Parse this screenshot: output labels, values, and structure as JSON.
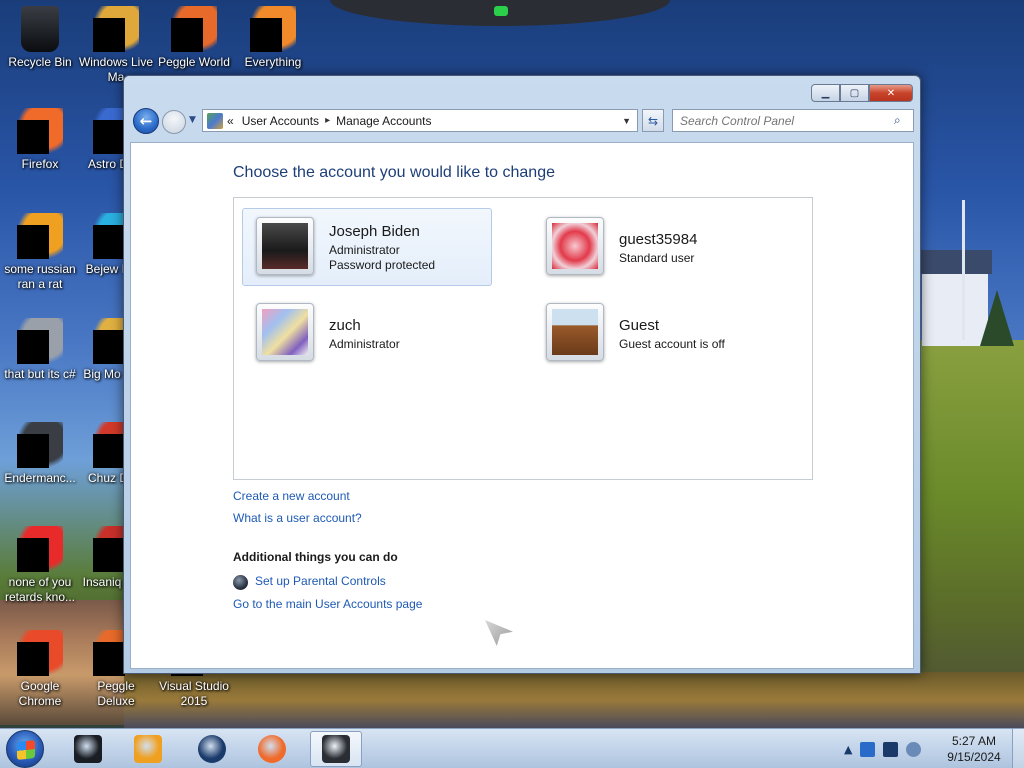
{
  "desktop": {
    "icons": [
      {
        "label": "Recycle Bin",
        "icon": "recycle-bin-icon",
        "color": "#1a1e24"
      },
      {
        "label": "Windows Live Ma",
        "icon": "windows-live-icon",
        "color": "#e0a83a"
      },
      {
        "label": "Peggle World",
        "icon": "peggle-world-icon",
        "color": "#e86a2a"
      },
      {
        "label": "Everything",
        "icon": "everything-icon",
        "color": "#f08a2a"
      },
      {
        "label": "Firefox",
        "icon": "firefox-icon",
        "color": "#f06a2a"
      },
      {
        "label": "Astro Delu",
        "icon": "astro-icon",
        "color": "#3a6ad0"
      },
      {
        "label": "some russian ran a rat",
        "icon": "shortcut-icon",
        "color": "#f0a020"
      },
      {
        "label": "Bejew Delu",
        "icon": "bejeweled-icon",
        "color": "#2ab0e0"
      },
      {
        "label": "that but its c#",
        "icon": "shortcut-icon",
        "color": "#9aa0aa"
      },
      {
        "label": "Big Mo Delu",
        "icon": "game-icon",
        "color": "#e0b040"
      },
      {
        "label": "Endermanc...",
        "icon": "app-icon",
        "color": "#3a3e44"
      },
      {
        "label": "Chuz Delu",
        "icon": "game-icon",
        "color": "#d03a2a"
      },
      {
        "label": "none of you retards kno...",
        "icon": "opera-icon",
        "color": "#e82a2a"
      },
      {
        "label": "Insaniq Delu",
        "icon": "game-icon",
        "color": "#c8302a"
      },
      {
        "label": "Google Chrome",
        "icon": "chrome-icon",
        "color": "#e84a2a"
      },
      {
        "label": "Peggle Deluxe",
        "icon": "peggle-icon",
        "color": "#e86a2a"
      },
      {
        "label": "Visual Studio 2015",
        "icon": "visual-studio-icon",
        "color": "#6a3aa8"
      }
    ]
  },
  "window": {
    "address": {
      "crumb_prefix": "«",
      "crumb_1": "User Accounts",
      "crumb_sep": "▸",
      "crumb_2": "Manage Accounts"
    },
    "search": {
      "placeholder": "Search Control Panel"
    },
    "title": "Choose the account you would like to change",
    "accounts": [
      {
        "name": "Joseph Biden",
        "line1": "Administrator",
        "line2": "Password protected",
        "picture": "account-picture-dark",
        "selected": true
      },
      {
        "name": "guest35984",
        "line1": "Standard user",
        "line2": "",
        "picture": "account-picture-star",
        "selected": false
      },
      {
        "name": "zuch",
        "line1": "Administrator",
        "line2": "",
        "picture": "account-picture-abstract",
        "selected": false
      },
      {
        "name": "Guest",
        "line1": "Guest account is off",
        "line2": "",
        "picture": "account-picture-briefcase",
        "selected": false
      }
    ],
    "links": {
      "create": "Create a new account",
      "what_is": "What is a user account?"
    },
    "additional": {
      "heading": "Additional things you can do",
      "parental": "Set up Parental Controls",
      "main_page": "Go to the main User Accounts page"
    }
  },
  "taskbar": {
    "items": [
      {
        "icon": "black-box-icon",
        "color": "#1a1e24"
      },
      {
        "icon": "media-player-icon",
        "color": "#f0a020"
      },
      {
        "icon": "globe-app-icon",
        "color": "#1a3a6a"
      },
      {
        "icon": "firefox-icon",
        "color": "#f06a2a"
      },
      {
        "icon": "user-accounts-icon",
        "color": "#2a2e34",
        "active": true
      }
    ],
    "tray": {
      "expand": "▲"
    },
    "clock": {
      "time": "5:27 AM",
      "date": "9/15/2024"
    }
  },
  "colors": {
    "link": "#1e5ab4",
    "title": "#1e3e78"
  }
}
